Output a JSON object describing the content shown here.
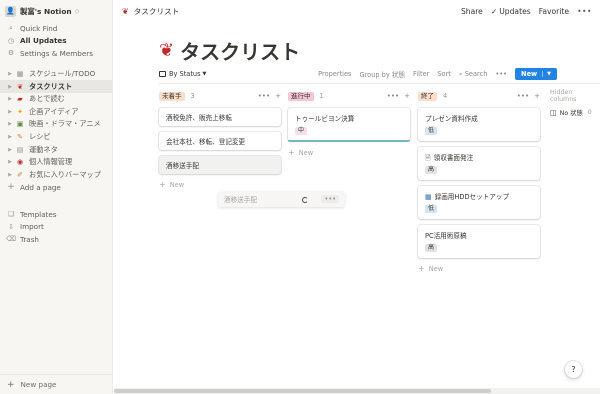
{
  "colors": {
    "accent": "#2383e2",
    "todo_tag": "#fadec9",
    "doing_tag": "#fdecc8",
    "done_tag": "#dbeddb",
    "badge_low": "#d3e5ef",
    "badge_mid": "#f5e0e9",
    "badge_high": "#e3e2e0"
  },
  "sidebar": {
    "workspace": "製富's Notion",
    "workspace_caret": "◇",
    "top": [
      {
        "icon": "search-icon",
        "label": "Quick Find"
      },
      {
        "icon": "clock-icon",
        "label": "All Updates"
      },
      {
        "icon": "gear-icon",
        "label": "Settings & Members"
      }
    ],
    "pages": [
      {
        "icon": "calendar-icon",
        "label": "スケジュール/TODO"
      },
      {
        "icon": "tooth-icon",
        "label": "タスクリスト"
      },
      {
        "icon": "book-icon",
        "label": "あとで読む"
      },
      {
        "icon": "bulb-icon",
        "label": "企画アイディア"
      },
      {
        "icon": "film-icon",
        "label": "映画・ドラマ・アニメ"
      },
      {
        "icon": "carrot-icon",
        "label": "レシピ"
      },
      {
        "icon": "notepad-icon",
        "label": "運動ネタ"
      },
      {
        "icon": "id-icon",
        "label": "個人情報管理"
      },
      {
        "icon": "map-icon",
        "label": "お気に入りバーマップ"
      }
    ],
    "add_page": "Add a page",
    "bottom": [
      {
        "icon": "templates-icon",
        "label": "Templates"
      },
      {
        "icon": "import-icon",
        "label": "Import"
      },
      {
        "icon": "trash-icon",
        "label": "Trash"
      }
    ],
    "new_page": "New page"
  },
  "topbar": {
    "breadcrumb": "タスクリスト",
    "share": "Share",
    "updates": "Updates",
    "favorite": "Favorite",
    "more": "•••"
  },
  "page": {
    "title": "タスクリスト"
  },
  "viewbar": {
    "view": "By Status",
    "properties": "Properties",
    "group_by": "Group by 状態",
    "filter": "Filter",
    "sort": "Sort",
    "search": "Search",
    "more": "•••",
    "new": "New"
  },
  "columns": [
    {
      "tag": "未着手",
      "count": "3",
      "cards": [
        "酒税免許、販売上移転",
        "会社本社、移転、登記変更",
        "酒移送手配"
      ],
      "new": "New"
    },
    {
      "tag": "進行中",
      "count": "1",
      "cards": [
        {
          "title": "トゥールビヨン決算",
          "badge": "中"
        }
      ],
      "new": "New"
    },
    {
      "tag": "終了",
      "count": "4",
      "cards": [
        {
          "title": "プレゼン資料作成",
          "badge": "低"
        },
        {
          "title": "領収書面発注",
          "badge": "高"
        },
        {
          "title": "録画用HDDセットアップ",
          "badge": "低"
        },
        {
          "title": "PC活用術原稿",
          "badge": "高"
        }
      ],
      "new": "New"
    }
  ],
  "drag_ghost": {
    "title": "酒移送手配",
    "more": "•••"
  },
  "hidden": {
    "title": "Hidden columns",
    "item": "No 状態",
    "count": "0"
  },
  "help": "?"
}
